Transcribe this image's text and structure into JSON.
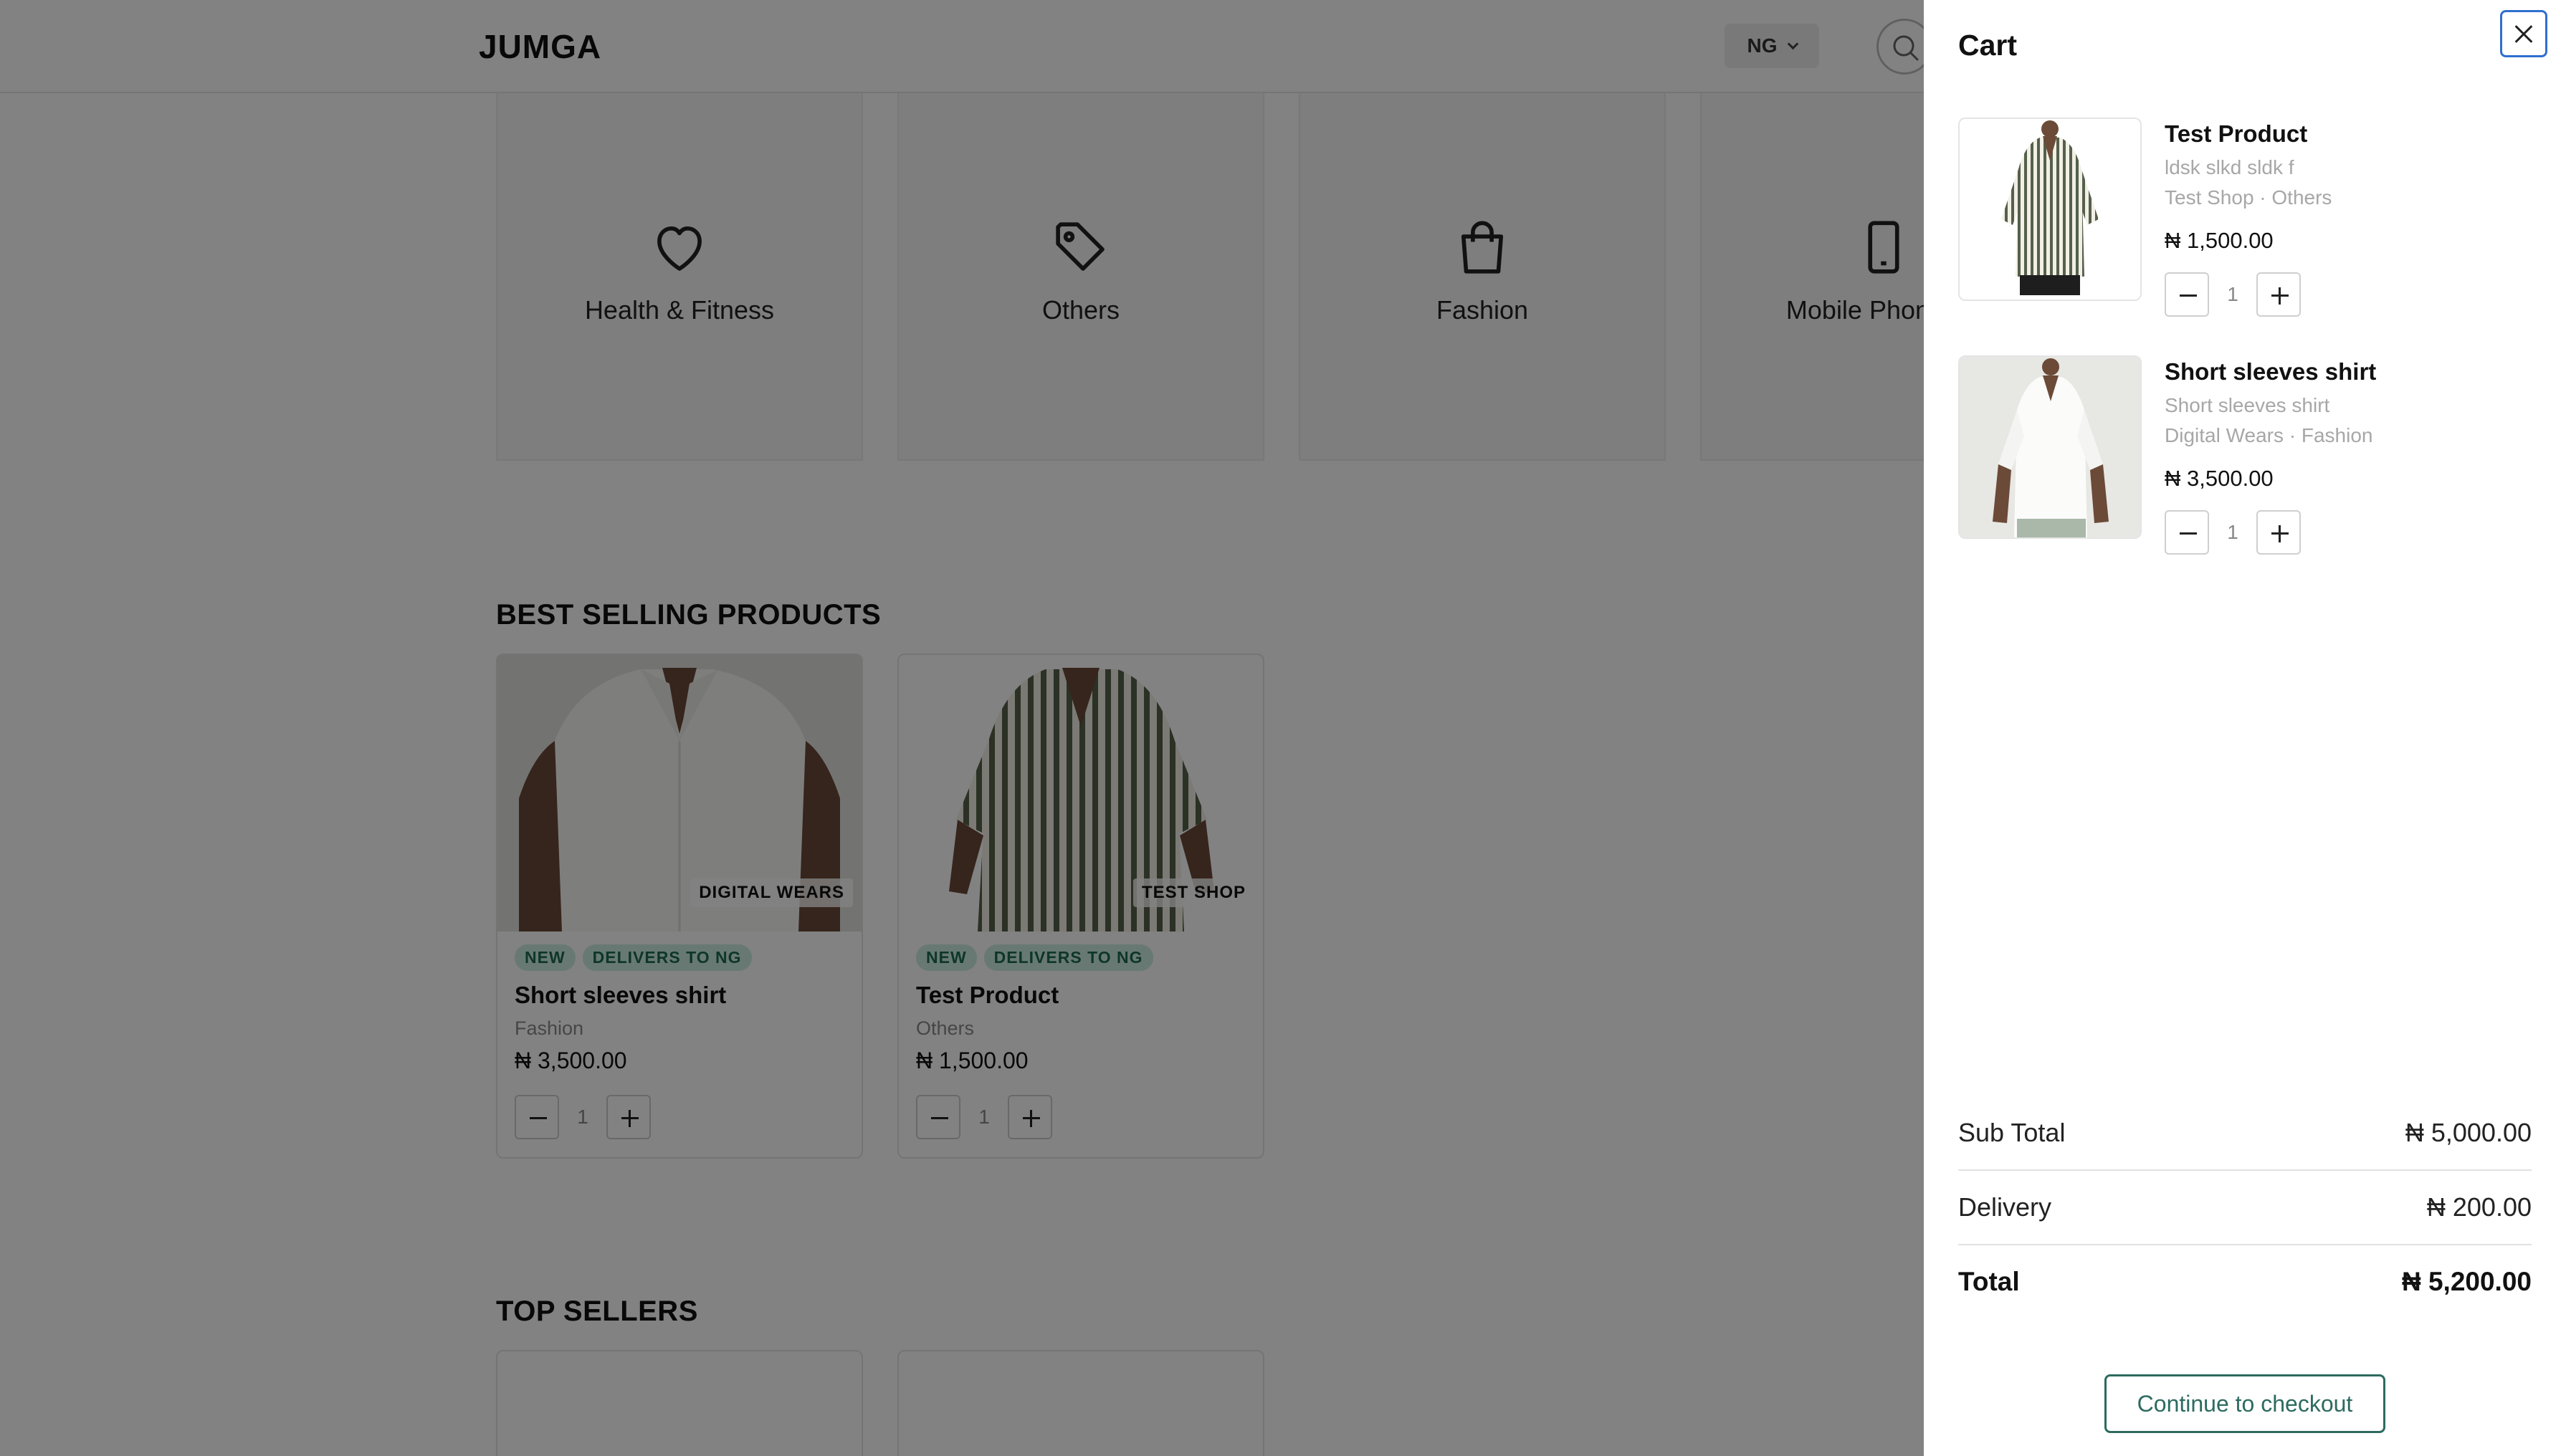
{
  "header": {
    "logo": "JUMGA",
    "country_code": "NG"
  },
  "categories": [
    {
      "label": "Health & Fitness",
      "icon": "heart-icon"
    },
    {
      "label": "Others",
      "icon": "tag-icon"
    },
    {
      "label": "Fashion",
      "icon": "shopping-bag-icon"
    },
    {
      "label": "Mobile Phones &",
      "icon": "mobile-phone-icon"
    }
  ],
  "best_selling": {
    "title": "BEST SELLING PRODUCTS",
    "products": [
      {
        "shop": "DIGITAL WEARS",
        "badges": [
          "NEW",
          "DELIVERS TO NG"
        ],
        "name": "Short sleeves shirt",
        "category": "Fashion",
        "price": "₦ 3,500.00",
        "qty": "1"
      },
      {
        "shop": "TEST SHOP",
        "badges": [
          "NEW",
          "DELIVERS TO NG"
        ],
        "name": "Test Product",
        "category": "Others",
        "price": "₦ 1,500.00",
        "qty": "1"
      }
    ]
  },
  "top_sellers": {
    "title": "TOP SELLERS"
  },
  "cart": {
    "title": "Cart",
    "items": [
      {
        "name": "Test Product",
        "description": "ldsk slkd sldk f",
        "meta": "Test Shop · Others",
        "price": "₦ 1,500.00",
        "qty": "1"
      },
      {
        "name": "Short sleeves shirt",
        "description": "Short sleeves shirt",
        "meta": "Digital Wears · Fashion",
        "price": "₦ 3,500.00",
        "qty": "1"
      }
    ],
    "subtotal_label": "Sub Total",
    "subtotal_value": "₦ 5,000.00",
    "delivery_label": "Delivery",
    "delivery_value": "₦ 200.00",
    "total_label": "Total",
    "total_value": "₦ 5,200.00",
    "checkout_label": "Continue to checkout"
  },
  "colors": {
    "accent": "#2d6b60",
    "badge_bg": "#cdeee2",
    "badge_text": "#1c6b52",
    "focus_ring": "#2f6fd0"
  }
}
